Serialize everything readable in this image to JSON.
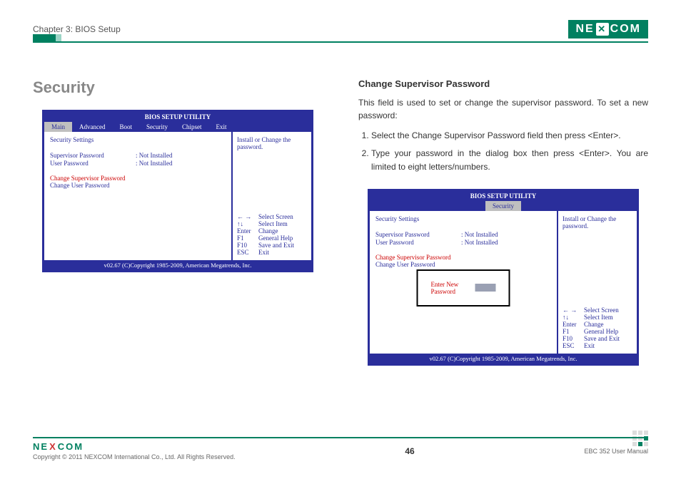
{
  "header": {
    "chapter": "Chapter 3: BIOS Setup",
    "logo_left": "NE",
    "logo_right": "COM"
  },
  "left": {
    "title": "Security"
  },
  "right": {
    "heading": "Change Supervisor Password",
    "para": "This field is used to set or change the supervisor password. To set a new password:",
    "step1": "Select the Change Supervisor Password field then press <Enter>.",
    "step2": "Type your password in the dialog box then press <Enter>. You are limited to eight letters/numbers."
  },
  "bios1": {
    "title": "BIOS SETUP UTILITY",
    "tabs": {
      "main": "Main",
      "advanced": "Advanced",
      "boot": "Boot",
      "security": "Security",
      "chipset": "Chipset",
      "exit": "Exit"
    },
    "section": "Security Settings",
    "sup_label": "Supervisor Password",
    "sup_val": ": Not Installed",
    "usr_label": "User Password",
    "usr_val": ": Not Installed",
    "change_sup": "Change Supervisor Password",
    "change_usr": "Change User Password",
    "side_hint": "Install or Change the password.",
    "help": {
      "lr_k": "← →",
      "lr_v": "Select Screen",
      "ud_k": "↑↓",
      "ud_v": "Select Item",
      "enter_k": "Enter",
      "enter_v": "Change",
      "f1_k": "F1",
      "f1_v": "General Help",
      "f10_k": "F10",
      "f10_v": "Save and Exit",
      "esc_k": "ESC",
      "esc_v": "Exit"
    },
    "footer": "v02.67 (C)Copyright 1985-2009, American Megatrends, Inc."
  },
  "bios2": {
    "title": "BIOS SETUP UTILITY",
    "tab": "Security",
    "section": "Security Settings",
    "sup_label": "Supervisor Password",
    "sup_val": ": Not Installed",
    "usr_label": "User Password",
    "usr_val": ": Not Installed",
    "change_sup": "Change Supervisor Password",
    "change_usr": "Change User Password",
    "dialog_label": "Enter New Password",
    "side_hint": "Install or Change the password.",
    "help": {
      "lr_k": "← →",
      "lr_v": "Select Screen",
      "ud_k": "↑↓",
      "ud_v": "Select Item",
      "enter_k": "Enter",
      "enter_v": "Change",
      "f1_k": "F1",
      "f1_v": "General Help",
      "f10_k": "F10",
      "f10_v": "Save and Exit",
      "esc_k": "ESC",
      "esc_v": "Exit"
    },
    "footer": "v02.67 (C)Copyright 1985-2009, American Megatrends, Inc."
  },
  "footer": {
    "logo_l": "NE",
    "logo_x": "X",
    "logo_r": "COM",
    "copyright": "Copyright © 2011 NEXCOM International Co., Ltd. All Rights Reserved.",
    "page": "46",
    "manual": "EBC 352 User Manual"
  }
}
